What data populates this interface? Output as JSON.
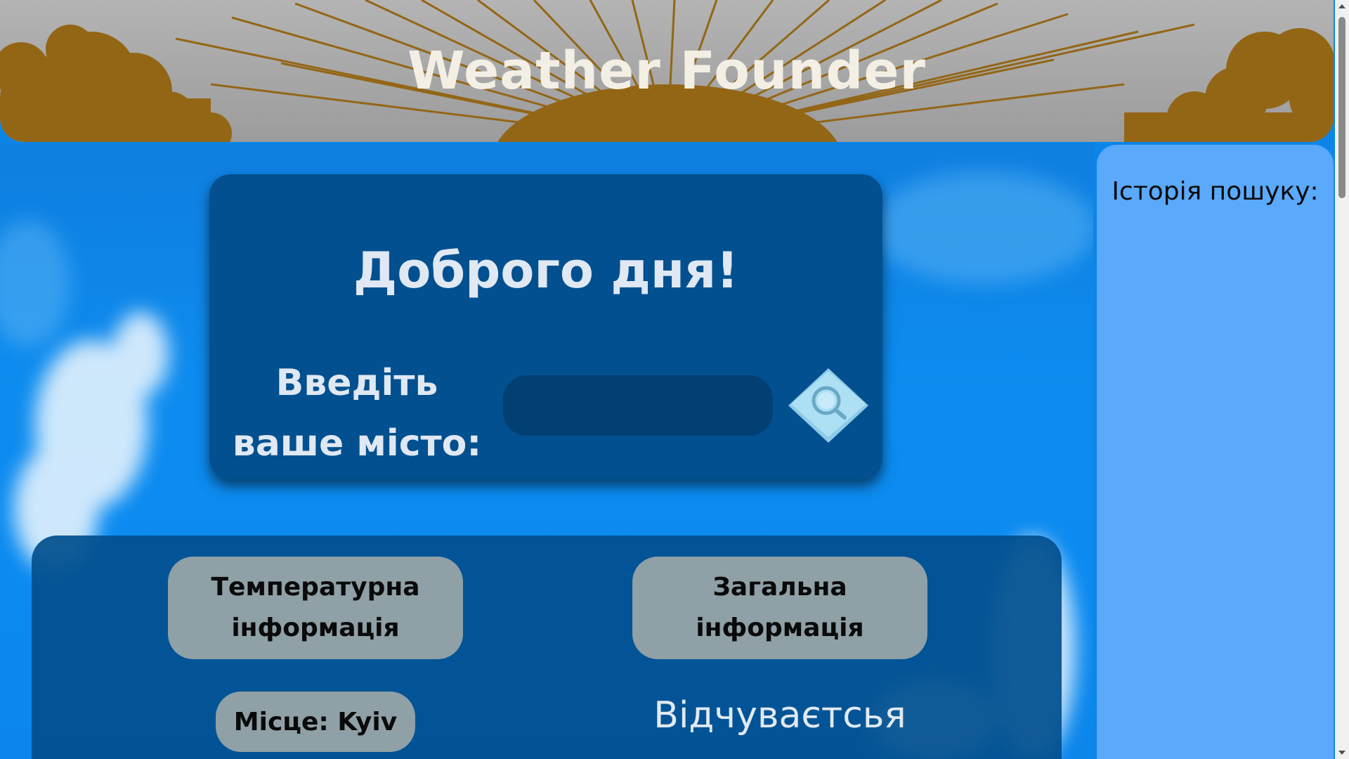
{
  "header": {
    "title": "Weather Founder"
  },
  "greeting": {
    "title": "Доброго дня!",
    "prompt": "Введіть ваше місто:",
    "input_value": "",
    "input_placeholder": ""
  },
  "info": {
    "temp_button": "Температурна інформація",
    "general_button": "Загальна інформація",
    "place_label": "Місце: Kyiv",
    "feels_label": "Відчуваєтсья"
  },
  "history": {
    "title": "Історія пошуку:"
  },
  "icons": {
    "search": "search-icon",
    "sun": "sun-rays-art",
    "clouds": "cloud-silhouettes"
  },
  "colors": {
    "header_art": "#936616",
    "card_bg": "#02508f",
    "input_bg": "#023f73",
    "pill_bg": "#8fa0a6",
    "sidebar_bg": "#5aa9fb",
    "search_btn": "#ade0f4"
  }
}
